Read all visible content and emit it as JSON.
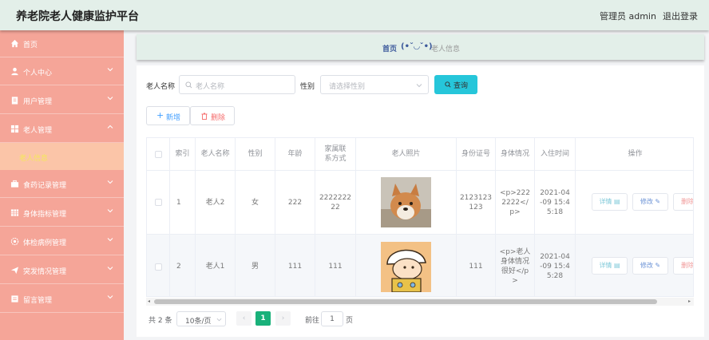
{
  "header": {
    "title": "养老院老人健康监护平台",
    "user": "管理员 admin",
    "logout": "退出登录"
  },
  "sidebar": {
    "items": [
      {
        "label": "首页",
        "icon": "home-icon"
      },
      {
        "label": "个人中心",
        "icon": "person-icon"
      },
      {
        "label": "用户管理",
        "icon": "clipboard-icon"
      },
      {
        "label": "老人管理",
        "icon": "grid-icon"
      },
      {
        "label": "食药记录管理",
        "icon": "briefcase-icon"
      },
      {
        "label": "身体指标管理",
        "icon": "table-icon"
      },
      {
        "label": "体检病例管理",
        "icon": "gear-icon"
      },
      {
        "label": "突发情况管理",
        "icon": "send-icon"
      },
      {
        "label": "留言管理",
        "icon": "message-icon"
      }
    ],
    "active_sub": "老人信息"
  },
  "breadcrumb": {
    "home": "首页",
    "emoji": "(•ˇ◡ˇ•)",
    "current": "老人信息"
  },
  "search": {
    "name_label": "老人名称",
    "name_placeholder": "老人名称",
    "gender_label": "性别",
    "gender_placeholder": "请选择性别",
    "query": "查询"
  },
  "actions": {
    "add": "新增",
    "delete": "删除"
  },
  "table": {
    "columns": [
      "索引",
      "老人名称",
      "性别",
      "年龄",
      "家属联系方式",
      "老人照片",
      "身份证号",
      "身体情况",
      "入住时间",
      "操作"
    ],
    "rows": [
      {
        "index": "1",
        "name": "老人2",
        "gender": "女",
        "age": "222",
        "phone": "2222222\n22",
        "photo": "dog-photo",
        "id_no": "2123123\n123",
        "health": "<p>222\n2222</\np>",
        "checkin": "2021-04\n-09 15:4\n5:18"
      },
      {
        "index": "2",
        "name": "老人1",
        "gender": "男",
        "age": "111",
        "phone": "111",
        "photo": "cartoon-photo",
        "id_no": "111",
        "health": "<p>老人\n身体情况\n很好</p\n>",
        "checkin": "2021-04\n-09 15:4\n5:28"
      }
    ],
    "ops": {
      "detail": "详情",
      "edit": "修改",
      "delete": "删除"
    }
  },
  "pagination": {
    "total": "共 2 条",
    "page_size": "10条/页",
    "current": "1",
    "goto_label": "前往",
    "goto_value": "1",
    "page_unit": "页"
  },
  "colors": {
    "header_bg": "#e3efe9",
    "sidebar_bg": "#f5a598",
    "active_sub_bg": "#fbc5a8",
    "accent": "#26c6da",
    "pager_active": "#19b17a"
  }
}
